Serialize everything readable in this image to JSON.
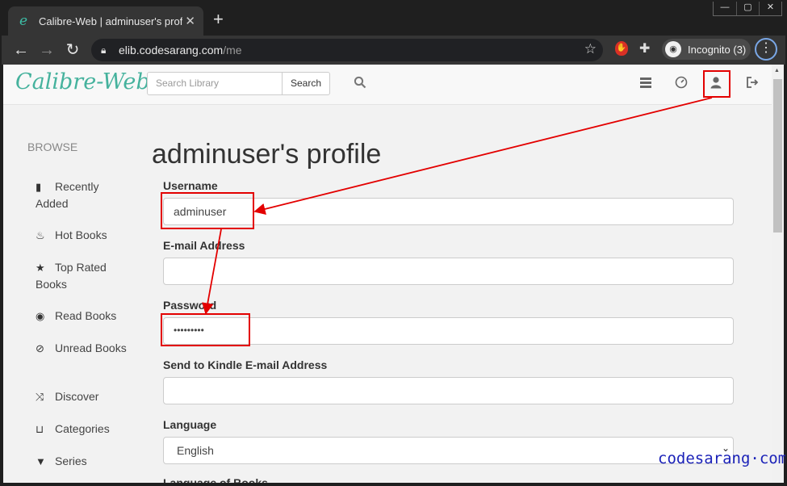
{
  "browser": {
    "tab_title": "Calibre-Web | adminuser's profile",
    "tab_favicon": "e",
    "close_tab": "✕",
    "new_tab": "+",
    "window_controls": [
      "—",
      "▢",
      "✕"
    ],
    "url_host": "elib.codesarang.com",
    "url_path": "/me",
    "incognito_label": "Incognito (3)",
    "icons": [
      "back-arrow-icon",
      "forward-arrow-icon",
      "reload-icon",
      "lock-icon",
      "star-icon",
      "extension-icon",
      "puzzle-icon",
      "incognito-icon",
      "menu-icon"
    ]
  },
  "navbar": {
    "brand": "Calibre-Web",
    "search_placeholder": "Search Library",
    "search_button": "Search",
    "icons": [
      "search-icon",
      "admin-settings-icon",
      "dashboard-icon",
      "user-profile-icon",
      "logout-icon"
    ]
  },
  "sidebar": {
    "heading": "BROWSE",
    "items": [
      {
        "label": "Recently Added",
        "icon": "book-icon"
      },
      {
        "label": "Hot Books",
        "icon": "fire-icon"
      },
      {
        "label": "Top Rated Books",
        "icon": "star-icon"
      },
      {
        "label": "Read Books",
        "icon": "eye-icon"
      },
      {
        "label": "Unread Books",
        "icon": "eye-slash-icon"
      },
      {
        "label": "Discover",
        "icon": "shuffle-icon"
      },
      {
        "label": "Categories",
        "icon": "inbox-icon"
      },
      {
        "label": "Series",
        "icon": "bookmark-icon"
      }
    ]
  },
  "profile": {
    "title": "adminuser's profile",
    "fields": {
      "username_label": "Username",
      "username_value": "adminuser",
      "email_label": "E-mail Address",
      "email_value": "",
      "password_label": "Password",
      "password_value": "•••••••••",
      "kindle_label": "Send to Kindle E-mail Address",
      "kindle_value": "",
      "language_label": "Language",
      "language_value": "English",
      "books_language_label": "Language of Books"
    }
  },
  "watermark": "codesarang·com",
  "annotation_color": "#e30000",
  "accent_color": "#45b29d"
}
